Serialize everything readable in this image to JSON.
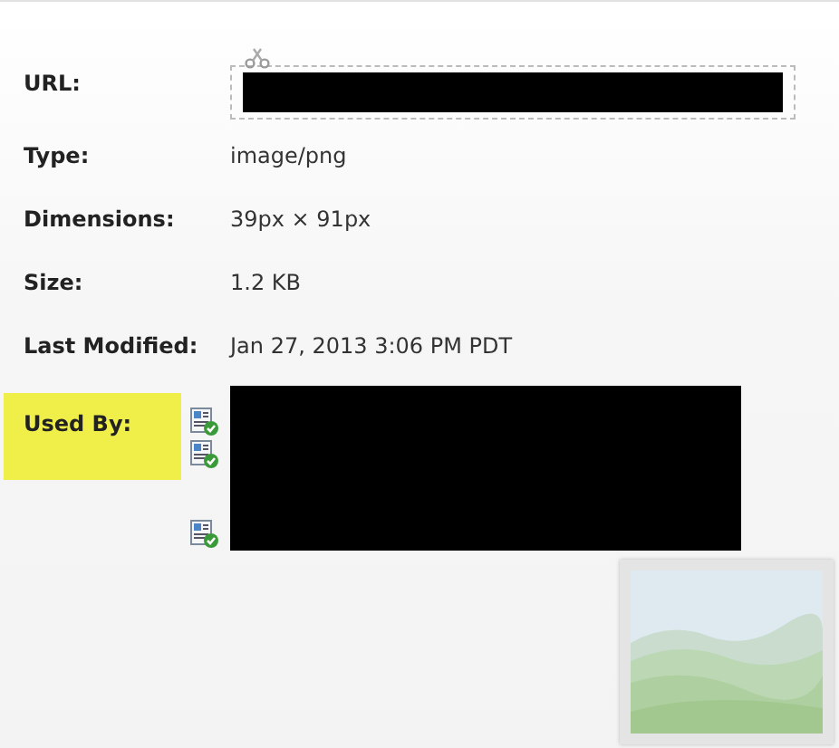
{
  "fields": [
    {
      "kind": "url",
      "label": "URL:",
      "highlighted": false
    },
    {
      "kind": "text",
      "label": "Type:",
      "value": "image/png",
      "highlighted": false
    },
    {
      "kind": "text",
      "label": "Dimensions:",
      "value": "39px × 91px",
      "highlighted": false
    },
    {
      "kind": "text",
      "label": "Size:",
      "value": "1.2 KB",
      "highlighted": false
    },
    {
      "kind": "text",
      "label": "Last Modified:",
      "value": "Jan 27, 2013 3:06 PM PDT",
      "highlighted": false
    },
    {
      "kind": "used_by",
      "label": "Used By:",
      "highlighted": true,
      "items": [
        {
          "kind": "page",
          "wrapped": false
        },
        {
          "kind": "page",
          "wrapped": true
        },
        {
          "kind": "page",
          "wrapped": false
        }
      ]
    }
  ]
}
